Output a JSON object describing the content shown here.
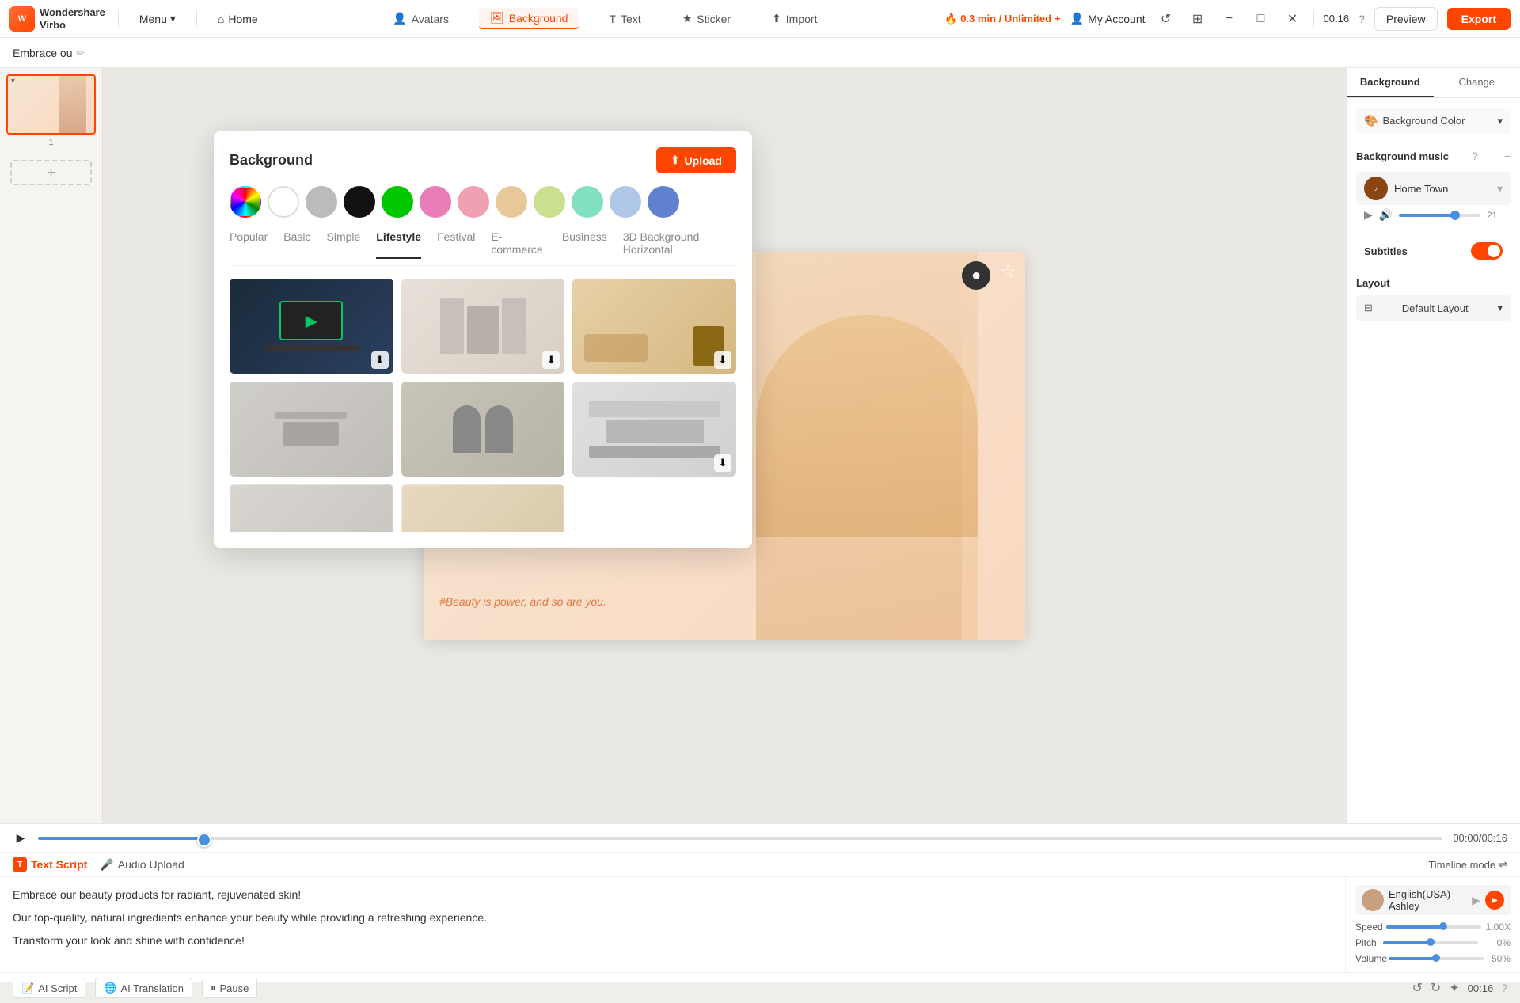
{
  "app": {
    "logo_text": "Wondershare\nVirbo",
    "logo_short": "W",
    "menu_label": "Menu",
    "home_label": "Home"
  },
  "topbar": {
    "tabs": [
      {
        "id": "avatars",
        "label": "Avatars",
        "active": false
      },
      {
        "id": "background",
        "label": "Background",
        "active": true
      },
      {
        "id": "text",
        "label": "Text",
        "active": false
      },
      {
        "id": "sticker",
        "label": "Sticker",
        "active": false
      },
      {
        "id": "import",
        "label": "Import",
        "active": false
      }
    ],
    "timer": "0.3 min / Unlimited",
    "my_account": "My Account",
    "time_display": "00:16",
    "preview_label": "Preview",
    "export_label": "Export"
  },
  "doc_title": "Embrace ou",
  "bg_popup": {
    "title": "Background",
    "upload_label": "Upload",
    "colors": [
      "gradient",
      "white",
      "lgray",
      "black",
      "green",
      "pink1",
      "pink2",
      "tan",
      "lgreen",
      "teal",
      "lblue",
      "blue"
    ],
    "categories": [
      {
        "label": "Popular",
        "active": false
      },
      {
        "label": "Basic",
        "active": false
      },
      {
        "label": "Simple",
        "active": false
      },
      {
        "label": "Lifestyle",
        "active": true
      },
      {
        "label": "Festival",
        "active": false
      },
      {
        "label": "E-commerce",
        "active": false
      },
      {
        "label": "Business",
        "active": false
      },
      {
        "label": "3D Background Horizontal",
        "active": false
      }
    ],
    "grid_items": [
      {
        "id": 1,
        "desc": "Tech desktop setup"
      },
      {
        "id": 2,
        "desc": "Living room curtains"
      },
      {
        "id": 3,
        "desc": "Modern living room"
      },
      {
        "id": 4,
        "desc": "Cozy living room"
      },
      {
        "id": 5,
        "desc": "Arched windows fireplace"
      },
      {
        "id": 6,
        "desc": "Modern kitchen"
      },
      {
        "id": 7,
        "desc": "Blurred interior 1"
      },
      {
        "id": 8,
        "desc": "Blurred interior 2"
      }
    ]
  },
  "right_panel": {
    "tabs": [
      {
        "label": "Background",
        "active": true
      },
      {
        "label": "Change",
        "active": false
      }
    ],
    "background_color_label": "Background Color",
    "background_music_label": "Background music",
    "music_title": "Home Town",
    "volume_value": "21",
    "subtitles_label": "Subtitles",
    "layout_label": "Layout",
    "default_layout": "Default Layout"
  },
  "bottom": {
    "timeline_time": "00:00/00:16",
    "text_script_label": "Text Script",
    "audio_upload_label": "Audio Upload",
    "timeline_mode_label": "Timeline mode",
    "script_lines": [
      "Embrace our beauty products for radiant, rejuvenated skin!",
      "Our top-quality, natural ingredients enhance your beauty while providing a refreshing experience.",
      "Transform your look and shine with confidence!"
    ],
    "voice_name": "English(USA)-Ashley",
    "speed_label": "Speed",
    "speed_value": "1.00X",
    "speed_pct": 60,
    "pitch_label": "Pitch",
    "pitch_value": "0%",
    "pitch_pct": 50,
    "volume_label": "Volume",
    "volume_value": "50%",
    "volume_pct": 50,
    "bottom_time": "00:16",
    "tools": [
      {
        "label": "AI Script"
      },
      {
        "label": "AI Translation"
      },
      {
        "label": "Pause"
      }
    ]
  },
  "canvas": {
    "tagline": "#Beauty is power, and so are you."
  }
}
